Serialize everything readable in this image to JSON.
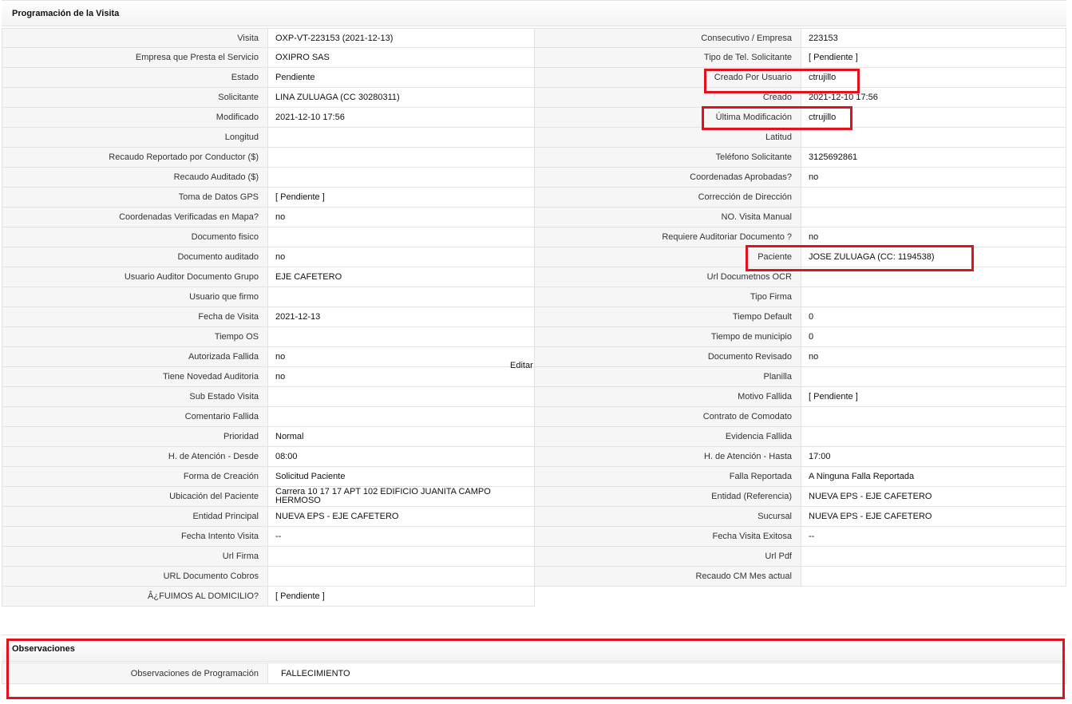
{
  "section_title": "Programación de la Visita",
  "rows": [
    {
      "l_label": "Visita",
      "l_value": "OXP-VT-223153 (2021-12-13)",
      "r_label": "Consecutivo / Empresa",
      "r_value": "223153"
    },
    {
      "l_label": "Empresa que Presta el Servicio",
      "l_value": "OXIPRO SAS",
      "r_label": "Tipo de Tel. Solicitante",
      "r_value": "[ Pendiente ]"
    },
    {
      "l_label": "Estado",
      "l_value": "Pendiente",
      "r_label": "Creado Por Usuario",
      "r_value": "ctrujillo"
    },
    {
      "l_label": "Solicitante",
      "l_value": "LINA ZULUAGA (CC 30280311)",
      "r_label": "Creado",
      "r_value": "2021-12-10 17:56"
    },
    {
      "l_label": "Modificado",
      "l_value": "2021-12-10 17:56",
      "r_label": "Última Modificación",
      "r_value": "ctrujillo"
    },
    {
      "l_label": "Longitud",
      "l_value": "",
      "r_label": "Latitud",
      "r_value": ""
    },
    {
      "l_label": "Recaudo Reportado por Conductor ($)",
      "l_value": "",
      "r_label": "Teléfono Solicitante",
      "r_value": "3125692861"
    },
    {
      "l_label": "Recaudo Auditado ($)",
      "l_value": "",
      "r_label": "Coordenadas Aprobadas?",
      "r_value": "no"
    },
    {
      "l_label": "Toma de Datos GPS",
      "l_value": "[ Pendiente ]",
      "r_label": "Corrección de Dirección",
      "r_value": ""
    },
    {
      "l_label": "Coordenadas Verificadas en Mapa?",
      "l_value": "no",
      "r_label": "NO. Visita Manual",
      "r_value": ""
    },
    {
      "l_label": "Documento fisico",
      "l_value": "",
      "r_label": "Requiere Auditoriar Documento ?",
      "r_value": "no"
    },
    {
      "l_label": "Documento auditado",
      "l_value": "no",
      "r_label": "Paciente",
      "r_value": "JOSE ZULUAGA (CC: 1194538)"
    },
    {
      "l_label": "Usuario Auditor Documento Grupo",
      "l_value": "EJE CAFETERO",
      "r_label": "Url Documetnos OCR",
      "r_value": ""
    },
    {
      "l_label": "Usuario que firmo",
      "l_value": "",
      "r_label": "Tipo Firma",
      "r_value": ""
    },
    {
      "l_label": "Fecha de Visita",
      "l_value": "2021-12-13",
      "r_label": "Tiempo Default",
      "r_value": "0"
    },
    {
      "l_label": "Tiempo OS",
      "l_value": "",
      "r_label": "Tiempo de municipio",
      "r_value": "0"
    },
    {
      "l_label": "Autorizada Fallida",
      "l_value": "no",
      "r_label": "Documento Revisado",
      "r_value": "no"
    },
    {
      "l_label": "Tiene Novedad Auditoria",
      "l_value": "no",
      "r_label": "Planilla",
      "r_value": ""
    },
    {
      "l_label": "Sub Estado Visita",
      "l_value": "",
      "r_label": "Motivo Fallida",
      "r_value": "[ Pendiente ]"
    },
    {
      "l_label": "Comentario Fallida",
      "l_value": "",
      "r_label": "Contrato de Comodato",
      "r_value": ""
    },
    {
      "l_label": "Prioridad",
      "l_value": "Normal",
      "r_label": "Evidencia Fallida",
      "r_value": ""
    },
    {
      "l_label": "H. de Atención - Desde",
      "l_value": "08:00",
      "r_label": "H. de Atención - Hasta",
      "r_value": "17:00"
    },
    {
      "l_label": "Forma de Creación",
      "l_value": "Solicitud Paciente",
      "r_label": "Falla Reportada",
      "r_value": "A Ninguna Falla Reportada"
    },
    {
      "l_label": "Ubicación del Paciente",
      "l_value": "Carrera 10 17 17 APT 102 EDIFICIO JUANITA CAMPO HERMOSO",
      "r_label": "Entidad (Referencia)",
      "r_value": "NUEVA EPS - EJE CAFETERO"
    },
    {
      "l_label": "Entidad Principal",
      "l_value": "NUEVA EPS - EJE CAFETERO",
      "r_label": "Sucursal",
      "r_value": "NUEVA EPS - EJE CAFETERO"
    },
    {
      "l_label": "Fecha Intento Visita",
      "l_value": "--",
      "r_label": "Fecha Visita Exitosa",
      "r_value": "--"
    },
    {
      "l_label": "Url Firma",
      "l_value": "",
      "r_label": "Url Pdf",
      "r_value": ""
    },
    {
      "l_label": "URL Documento Cobros",
      "l_value": "",
      "r_label": "Recaudo CM Mes actual",
      "r_value": ""
    },
    {
      "l_label": "Â¿FUIMOS AL DOMICILIO?",
      "l_value": "[ Pendiente ]",
      "r_label": "",
      "r_value": ""
    }
  ],
  "edit_link": "Editar",
  "observaciones": {
    "title": "Observaciones",
    "label": "Observaciones de Programación",
    "value": "FALLECIMIENTO"
  }
}
